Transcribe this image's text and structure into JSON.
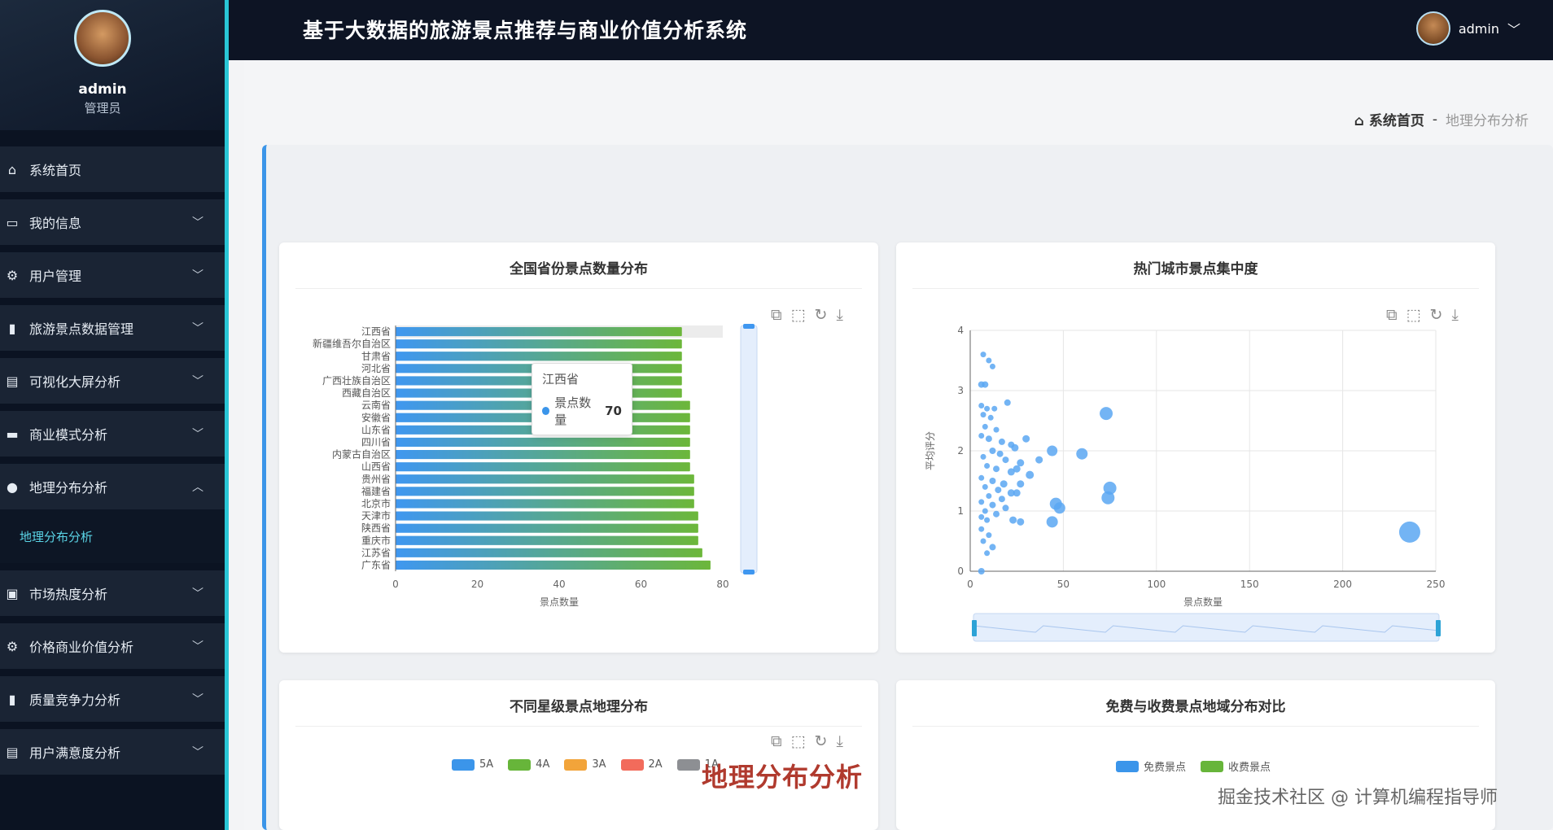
{
  "header": {
    "title": "基于大数据的旅游景点推荐与商业价值分析系统",
    "username": "admin"
  },
  "sidebar": {
    "user": {
      "name": "admin",
      "role": "管理员"
    },
    "items": [
      {
        "label": "系统首页",
        "icon": "home-icon"
      },
      {
        "label": "我的信息",
        "icon": "id-card-icon"
      },
      {
        "label": "用户管理",
        "icon": "gear-icon"
      },
      {
        "label": "旅游景点数据管理",
        "icon": "bar-chart-icon"
      },
      {
        "label": "可视化大屏分析",
        "icon": "clipboard-icon"
      },
      {
        "label": "商业模式分析",
        "icon": "monitor-icon"
      },
      {
        "label": "地理分布分析",
        "icon": "user-icon"
      },
      {
        "label": "市场热度分析",
        "icon": "wallet-icon"
      },
      {
        "label": "价格商业价值分析",
        "icon": "gear-icon"
      },
      {
        "label": "质量竞争力分析",
        "icon": "bar-chart-icon"
      },
      {
        "label": "用户满意度分析",
        "icon": "clipboard-icon"
      }
    ],
    "active_sub": "地理分布分析"
  },
  "breadcrumb": {
    "home": "系统首页",
    "sep": "-",
    "current": "地理分布分析"
  },
  "cards": {
    "c1_title": "全国省份景点数量分布",
    "c2_title": "热门城市景点集中度",
    "c3_title": "不同星级景点地理分布",
    "c4_title": "免费与收费景点地域分布对比"
  },
  "tooltip": {
    "title": "江西省",
    "label": "景点数量",
    "value": "70"
  },
  "legend_star": [
    "5A",
    "4A",
    "3A",
    "2A",
    "1A"
  ],
  "legend_star_colors": [
    "#3b95ea",
    "#67b53a",
    "#f2a43a",
    "#f26b5b",
    "#8d8f93"
  ],
  "legend_fee": [
    "免费景点",
    "收费景点"
  ],
  "legend_fee_colors": [
    "#3b95ea",
    "#67b53a"
  ],
  "watermarks": {
    "red": "地理分布分析",
    "gray": "掘金技术社区 @ 计算机编程指导师"
  },
  "chart_data": [
    {
      "type": "bar",
      "orientation": "horizontal",
      "title": "全国省份景点数量分布",
      "xlabel": "景点数量",
      "xlim": [
        0,
        80
      ],
      "x_ticks": [
        0,
        20,
        40,
        60,
        80
      ],
      "categories": [
        "江西省",
        "新疆维吾尔自治区",
        "甘肃省",
        "河北省",
        "广西壮族自治区",
        "西藏自治区",
        "云南省",
        "安徽省",
        "山东省",
        "四川省",
        "内蒙古自治区",
        "山西省",
        "贵州省",
        "福建省",
        "北京市",
        "天津市",
        "陕西省",
        "重庆市",
        "江苏省",
        "广东省"
      ],
      "values": [
        70,
        70,
        70,
        70,
        70,
        70,
        72,
        72,
        72,
        72,
        72,
        72,
        73,
        73,
        73,
        74,
        74,
        74,
        75,
        77
      ],
      "colors": [
        "#3f97f0",
        "#6cb73a"
      ]
    },
    {
      "type": "scatter",
      "title": "热门城市景点集中度",
      "xlabel": "景点数量",
      "ylabel": "平均评分",
      "xlim": [
        0,
        250
      ],
      "ylim": [
        0,
        4
      ],
      "x_ticks": [
        0,
        50,
        100,
        150,
        200,
        250
      ],
      "y_ticks": [
        0,
        1,
        2,
        3,
        4
      ],
      "color": "#5aa7f2",
      "points": [
        [
          7,
          3.6
        ],
        [
          10,
          3.5
        ],
        [
          12,
          3.4
        ],
        [
          6,
          3.1
        ],
        [
          8,
          3.1
        ],
        [
          20,
          2.8
        ],
        [
          6,
          2.75
        ],
        [
          9,
          2.7
        ],
        [
          13,
          2.7
        ],
        [
          7,
          2.6
        ],
        [
          11,
          2.55
        ],
        [
          8,
          2.4
        ],
        [
          14,
          2.35
        ],
        [
          6,
          2.25
        ],
        [
          10,
          2.2
        ],
        [
          17,
          2.15
        ],
        [
          22,
          2.1
        ],
        [
          30,
          2.2
        ],
        [
          24,
          2.05
        ],
        [
          12,
          2.0
        ],
        [
          16,
          1.95
        ],
        [
          7,
          1.9
        ],
        [
          19,
          1.85
        ],
        [
          27,
          1.8
        ],
        [
          37,
          1.85
        ],
        [
          9,
          1.75
        ],
        [
          14,
          1.7
        ],
        [
          22,
          1.65
        ],
        [
          25,
          1.7
        ],
        [
          32,
          1.6
        ],
        [
          6,
          1.55
        ],
        [
          12,
          1.5
        ],
        [
          18,
          1.45
        ],
        [
          27,
          1.45
        ],
        [
          8,
          1.4
        ],
        [
          15,
          1.35
        ],
        [
          22,
          1.3
        ],
        [
          10,
          1.25
        ],
        [
          17,
          1.2
        ],
        [
          25,
          1.3
        ],
        [
          6,
          1.15
        ],
        [
          12,
          1.1
        ],
        [
          19,
          1.05
        ],
        [
          8,
          1.0
        ],
        [
          14,
          0.95
        ],
        [
          6,
          0.9
        ],
        [
          9,
          0.85
        ],
        [
          23,
          0.85
        ],
        [
          27,
          0.82
        ],
        [
          6,
          0.7
        ],
        [
          10,
          0.6
        ],
        [
          7,
          0.5
        ],
        [
          12,
          0.4
        ],
        [
          9,
          0.3
        ],
        [
          6,
          0.0
        ],
        [
          44,
          2.0
        ],
        [
          60,
          1.95
        ],
        [
          73,
          2.62
        ],
        [
          75,
          1.38
        ],
        [
          74,
          1.22
        ],
        [
          46,
          1.12
        ],
        [
          48,
          1.05
        ],
        [
          44,
          0.82
        ],
        [
          236,
          0.65
        ]
      ],
      "sizes": [
        5,
        5,
        5,
        6,
        6,
        6,
        5,
        5,
        5,
        5,
        5,
        5,
        5,
        5,
        6,
        6,
        6,
        7,
        7,
        6,
        6,
        5,
        6,
        7,
        7,
        5,
        6,
        7,
        7,
        8,
        5,
        6,
        7,
        7,
        5,
        6,
        7,
        5,
        6,
        7,
        5,
        6,
        6,
        5,
        6,
        5,
        5,
        7,
        7,
        5,
        5,
        5,
        6,
        5,
        6,
        11,
        12,
        14,
        14,
        14,
        13,
        12,
        12,
        24
      ]
    }
  ]
}
